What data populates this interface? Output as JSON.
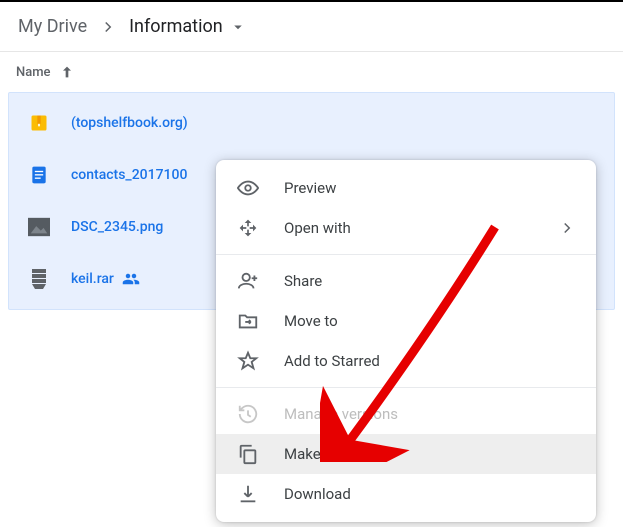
{
  "breadcrumb": {
    "root": "My Drive",
    "current": "Information"
  },
  "columns": {
    "name": "Name"
  },
  "files": [
    {
      "icon": "zip",
      "name": "(topshelfbook.org)",
      "shared": false
    },
    {
      "icon": "doc",
      "name": "contacts_2017100",
      "shared": false
    },
    {
      "icon": "image",
      "name": "DSC_2345.png",
      "shared": false
    },
    {
      "icon": "rar",
      "name": "keil.rar",
      "shared": true
    }
  ],
  "context_menu": {
    "preview": "Preview",
    "open_with": "Open with",
    "share": "Share",
    "move_to": "Move to",
    "add_starred": "Add to Starred",
    "manage_versions": "Manage versions",
    "make_copy": "Make a copy",
    "download": "Download"
  }
}
